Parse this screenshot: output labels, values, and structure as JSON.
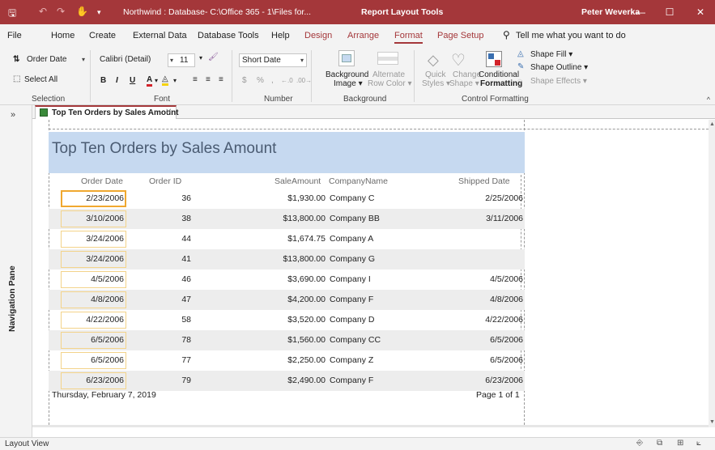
{
  "titlebar": {
    "save_glyph": "🖫",
    "undo_glyph": "↶",
    "redo_glyph": "↷",
    "touch_glyph": "✋",
    "customize_glyph": "▾",
    "title": "Northwind : Database- C:\\Office 365 - 1\\Files for...",
    "context_tools": "Report Layout Tools",
    "user": "Peter Weverka",
    "minimize_glyph": "—",
    "restore_glyph": "☐",
    "close_glyph": "✕"
  },
  "menu": {
    "tabs": [
      "File",
      "Home",
      "Create",
      "External Data",
      "Database Tools",
      "Help",
      "Design",
      "Arrange",
      "Format",
      "Page Setup"
    ],
    "active_tab": "Format",
    "tell_me": "Tell me what you want to do",
    "tell_me_glyph": "⚲"
  },
  "ribbon": {
    "selection": {
      "object_select": "Order Date",
      "select_all": "Select All",
      "group_label": "Selection"
    },
    "font": {
      "font_name": "Calibri (Detail)",
      "font_size": "11",
      "bold": "B",
      "italic": "I",
      "underline": "U",
      "font_color": "A",
      "group_label": "Font"
    },
    "number": {
      "format": "Short Date",
      "currency": "$",
      "percent": "%",
      "comma": ",",
      "increase_decimals": "←.0",
      "decrease_decimals": ".00→",
      "group_label": "Number"
    },
    "background": {
      "background_image_1": "Background",
      "background_image_2": "Image ▾",
      "alternate_row_color_1": "Alternate",
      "alternate_row_color_2": "Row Color ▾",
      "group_label": "Background"
    },
    "control_formatting": {
      "quick_styles_1": "Quick",
      "quick_styles_2": "Styles ▾",
      "change_shape_1": "Change",
      "change_shape_2": "Shape ▾",
      "conditional_1": "Conditional",
      "conditional_2": "Formatting",
      "shape_fill": "Shape Fill ▾",
      "shape_outline": "Shape Outline ▾",
      "shape_effects": "Shape Effects ▾",
      "group_label": "Control Formatting"
    },
    "collapse_glyph": "^"
  },
  "nav_pane": {
    "expand_glyph": "»",
    "label": "Navigation Pane"
  },
  "document_tab": {
    "label": "Top Ten Orders by Sales Amount",
    "close_glyph": "✕"
  },
  "report": {
    "title": "Top Ten Orders by Sales Amount",
    "columns": {
      "order_date": "Order Date",
      "order_id": "Order ID",
      "sale_amount": "SaleAmount",
      "company_name": "CompanyName",
      "shipped_date": "Shipped Date"
    },
    "rows": [
      {
        "order_date": "2/23/2006",
        "order_id": "36",
        "sale_amount": "$1,930.00",
        "company": "Company C",
        "shipped_date": "2/25/2006"
      },
      {
        "order_date": "3/10/2006",
        "order_id": "38",
        "sale_amount": "$13,800.00",
        "company": "Company BB",
        "shipped_date": "3/11/2006"
      },
      {
        "order_date": "3/24/2006",
        "order_id": "44",
        "sale_amount": "$1,674.75",
        "company": "Company A",
        "shipped_date": ""
      },
      {
        "order_date": "3/24/2006",
        "order_id": "41",
        "sale_amount": "$13,800.00",
        "company": "Company G",
        "shipped_date": ""
      },
      {
        "order_date": "4/5/2006",
        "order_id": "46",
        "sale_amount": "$3,690.00",
        "company": "Company I",
        "shipped_date": "4/5/2006"
      },
      {
        "order_date": "4/8/2006",
        "order_id": "47",
        "sale_amount": "$4,200.00",
        "company": "Company F",
        "shipped_date": "4/8/2006"
      },
      {
        "order_date": "4/22/2006",
        "order_id": "58",
        "sale_amount": "$3,520.00",
        "company": "Company D",
        "shipped_date": "4/22/2006"
      },
      {
        "order_date": "6/5/2006",
        "order_id": "78",
        "sale_amount": "$1,560.00",
        "company": "Company CC",
        "shipped_date": "6/5/2006"
      },
      {
        "order_date": "6/5/2006",
        "order_id": "77",
        "sale_amount": "$2,250.00",
        "company": "Company Z",
        "shipped_date": "6/5/2006"
      },
      {
        "order_date": "6/23/2006",
        "order_id": "79",
        "sale_amount": "$2,490.00",
        "company": "Company F",
        "shipped_date": "6/23/2006"
      }
    ],
    "footer_date": "Thursday, February 7, 2019",
    "footer_page": "Page 1 of 1"
  },
  "status_bar": {
    "view": "Layout View"
  },
  "colors": {
    "accent": "#a4373a",
    "header_band": "#c6d9f0",
    "selection_outline": "#f0a830"
  }
}
